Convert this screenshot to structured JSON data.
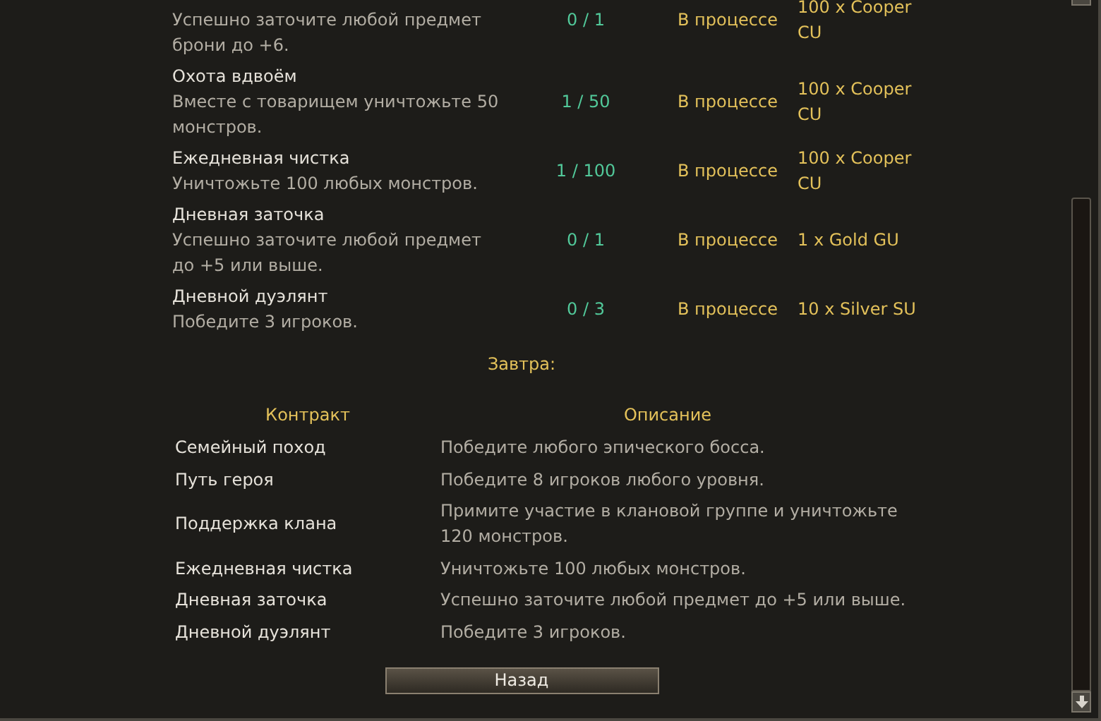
{
  "contracts": [
    {
      "description": "Успешно заточите любой предмет брони до +6.",
      "progress": "0 / 1",
      "status": "В процессе",
      "reward": "100 x Cooper CU"
    },
    {
      "name": "Охота вдвоём",
      "description": "Вместе с товарищем уничтожьте 50 монстров.",
      "progress": "1 / 50",
      "status": "В процессе",
      "reward": "100 x Cooper CU"
    },
    {
      "name": "Ежедневная чистка",
      "description": "Уничтожьте 100 любых монстров.",
      "progress": "1 / 100",
      "status": "В процессе",
      "reward": "100 x Cooper CU"
    },
    {
      "name": "Дневная заточка",
      "description": "Успешно заточите любой предмет до +5 или выше.",
      "progress": "0 / 1",
      "status": "В процессе",
      "reward": "1 x Gold GU"
    },
    {
      "name": "Дневной дуэлянт",
      "description": "Победите 3 игроков.",
      "progress": "0 / 3",
      "status": "В процессе",
      "reward": "10 x Silver SU"
    }
  ],
  "tomorrow": {
    "title": "Завтра:",
    "columns": [
      "Контракт",
      "Описание"
    ],
    "rows": [
      {
        "name": "Семейный поход",
        "description": "Победите любого эпического босса."
      },
      {
        "name": "Путь героя",
        "description": "Победите 8 игроков любого уровня."
      },
      {
        "name": "Поддержка клана",
        "description": "Примите участие в клановой группе и уничтожьте 120 монстров."
      },
      {
        "name": "Ежедневная чистка",
        "description": "Уничтожьте 100 любых монстров."
      },
      {
        "name": "Дневная заточка",
        "description": "Успешно заточите любой предмет до +5 или выше."
      },
      {
        "name": "Дневной дуэлянт",
        "description": "Победите 3 игроков."
      }
    ]
  },
  "back_button": "Назад"
}
